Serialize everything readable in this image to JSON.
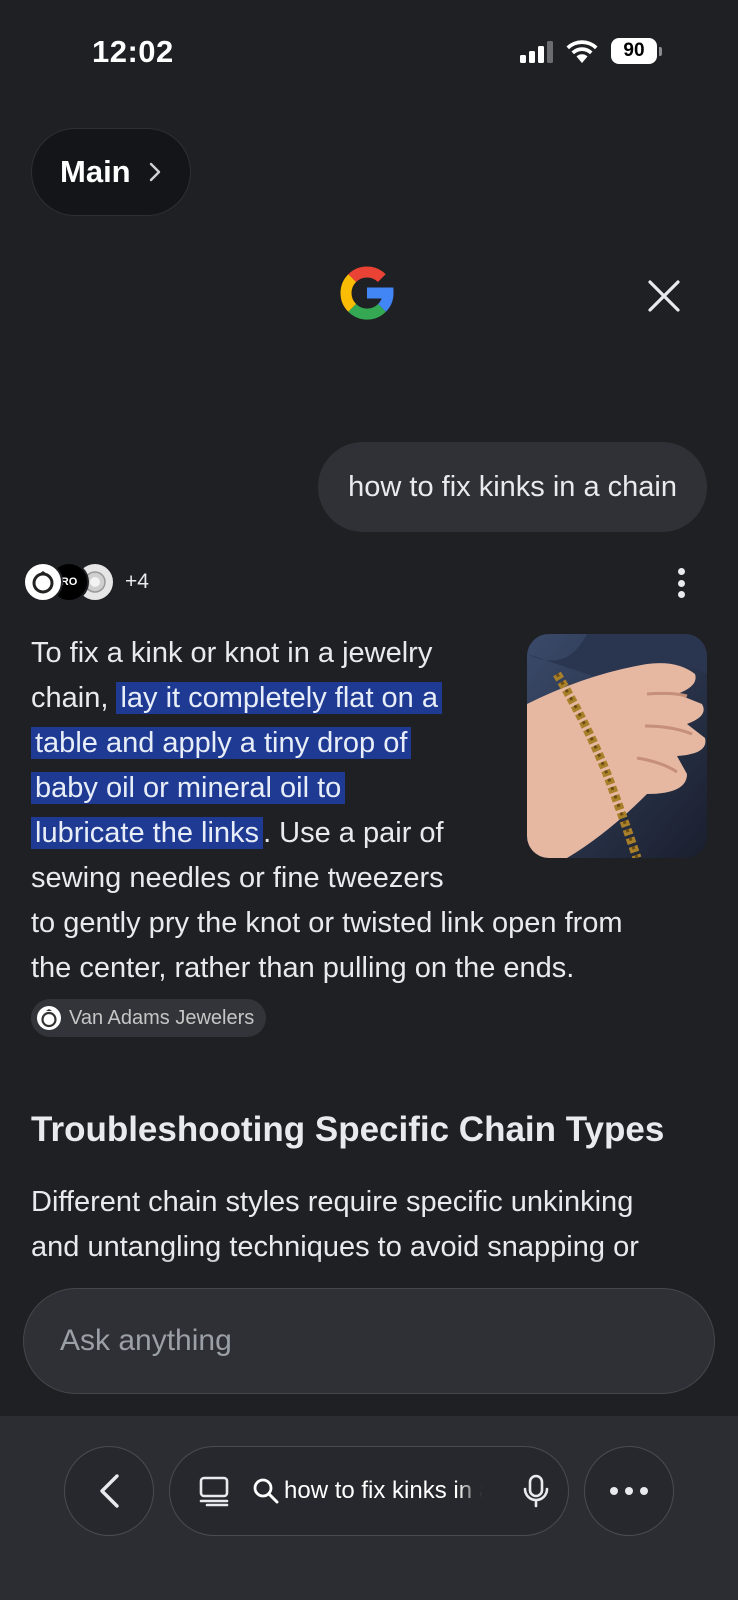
{
  "status": {
    "time": "12:02",
    "battery": "90"
  },
  "nav": {
    "main_label": "Main"
  },
  "query": "how to fix kinks in a chain",
  "sources": {
    "more_count": "+4",
    "icon2_text": "RO"
  },
  "answer": {
    "line1": "To fix a kink or knot in a jewelry",
    "line2_pre": "chain, ",
    "line2_hl": "lay it completely flat on a",
    "line3_hl": "table and apply a tiny drop of",
    "line4_hl": "baby oil or mineral oil to",
    "line5_hl": "lubricate the links",
    "line5_post": ". Use a pair of",
    "line6": "sewing needles or fine tweezers",
    "line7": "to gently pry the knot or twisted link open from",
    "line8": "the center, rather than pulling on the ends."
  },
  "citation": {
    "label": "Van Adams Jewelers"
  },
  "section": {
    "title": "Troubleshooting Specific Chain Types",
    "body_line1": "Different chain styles require specific unkinking",
    "body_line2": "and untangling techniques to avoid snapping or"
  },
  "ask": {
    "placeholder": "Ask anything"
  },
  "toolbar": {
    "url_text": "how to fix kinks in a chain"
  },
  "colors": {
    "background": "#1f2024",
    "highlight": "#1f3a93",
    "bubble": "#303136"
  },
  "icons": [
    "chevron-right-icon",
    "google-logo",
    "close-icon",
    "more-vert-icon",
    "back-icon",
    "reader-icon",
    "search-icon",
    "mic-icon",
    "more-horiz-icon"
  ]
}
